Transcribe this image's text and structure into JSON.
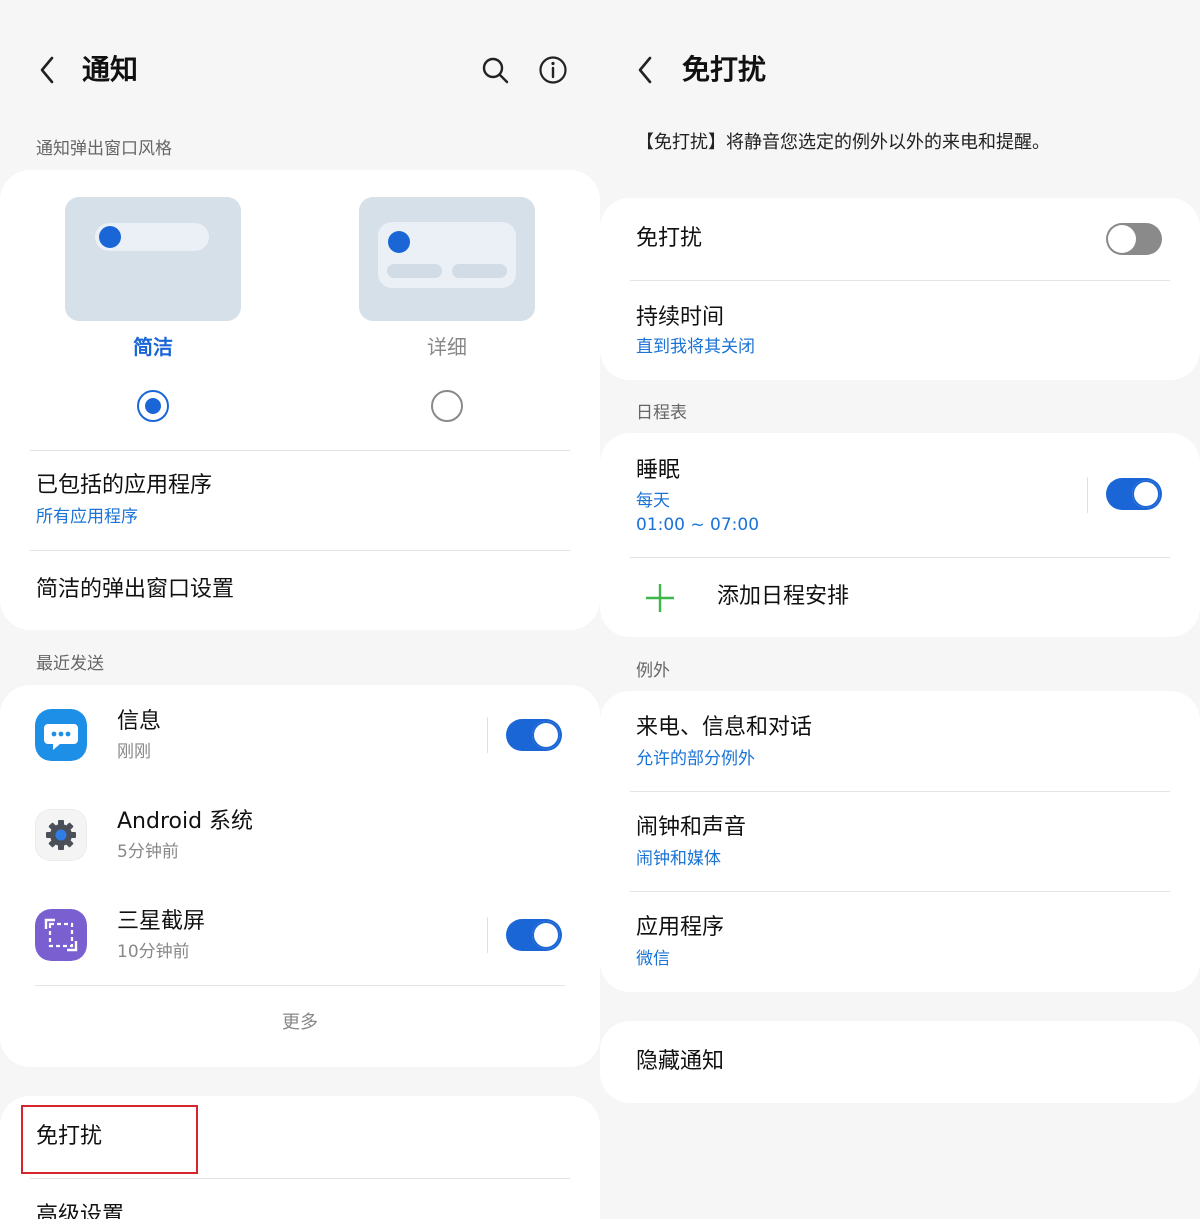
{
  "left": {
    "title": "通知",
    "popup_style_label": "通知弹出窗口风格",
    "styles": [
      {
        "label": "简洁",
        "selected": true
      },
      {
        "label": "详细",
        "selected": false
      }
    ],
    "included_apps": {
      "title": "已包括的应用程序",
      "sub": "所有应用程序"
    },
    "brief_popup_settings": "简洁的弹出窗口设置",
    "recent_label": "最近发送",
    "recent": [
      {
        "name": "信息",
        "time": "刚刚",
        "toggle": "on",
        "icon": "messages-icon"
      },
      {
        "name": "Android 系统",
        "time": "5分钟前",
        "toggle": null,
        "icon": "android-system-gear-icon"
      },
      {
        "name": "三星截屏",
        "time": "10分钟前",
        "toggle": "on",
        "icon": "samsung-screenshot-icon"
      }
    ],
    "more": "更多",
    "dnd": "免打扰",
    "advanced": "高级设置"
  },
  "right": {
    "title": "免打扰",
    "description": "【免打扰】将静音您选定的例外以外的来电和提醒。",
    "dnd_toggle": {
      "label": "免打扰",
      "state": "off"
    },
    "duration": {
      "title": "持续时间",
      "sub": "直到我将其关闭"
    },
    "schedule_label": "日程表",
    "sleep": {
      "title": "睡眠",
      "sub1": "每天",
      "sub2": "01:00 ~ 07:00",
      "state": "on"
    },
    "add_schedule": "添加日程安排",
    "exceptions_label": "例外",
    "exceptions": [
      {
        "title": "来电、信息和对话",
        "sub": "允许的部分例外"
      },
      {
        "title": "闹钟和声音",
        "sub": "闹钟和媒体"
      },
      {
        "title": "应用程序",
        "sub": "微信"
      }
    ],
    "hide_notifications": "隐藏通知"
  },
  "colors": {
    "accent": "#1b66d6",
    "highlight": "#d6252c",
    "plus": "#3cb84a"
  }
}
